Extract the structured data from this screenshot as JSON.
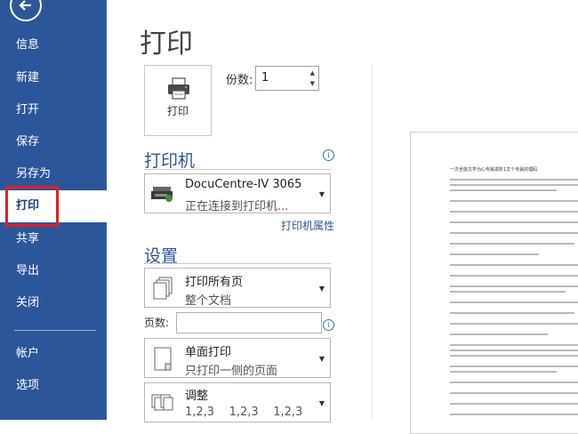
{
  "nav": {
    "items": [
      {
        "label": "信息"
      },
      {
        "label": "新建"
      },
      {
        "label": "打开"
      },
      {
        "label": "保存"
      },
      {
        "label": "另存为"
      },
      {
        "label": "打印"
      },
      {
        "label": "共享"
      },
      {
        "label": "导出"
      },
      {
        "label": "关闭"
      },
      {
        "label": "帐户"
      },
      {
        "label": "选项"
      }
    ],
    "active": "打印",
    "colors": {
      "background": "#2b579a",
      "highlight": "#e02020"
    }
  },
  "main": {
    "title": "打印",
    "print_button_label": "打印",
    "copies_label": "份数:",
    "copies_value": "1",
    "printer_section": "打印机",
    "printer_name": "DocuCentre-IV 3065",
    "printer_status": "正在连接到打印机...",
    "printer_properties": "打印机属性",
    "settings_section": "设置",
    "setting_pages_main": "打印所有页",
    "setting_pages_sub": "整个文档",
    "pages_label": "页数:",
    "pages_value": "",
    "setting_sides_main": "单面打印",
    "setting_sides_sub": "只打印一侧的页面",
    "setting_collate_main": "调整",
    "setting_collate_sub": "1,2,3    1,2,3    1,2,3"
  },
  "preview": {
    "page_title": "一次全能文学为心专属进阶1文个专属的理码"
  }
}
